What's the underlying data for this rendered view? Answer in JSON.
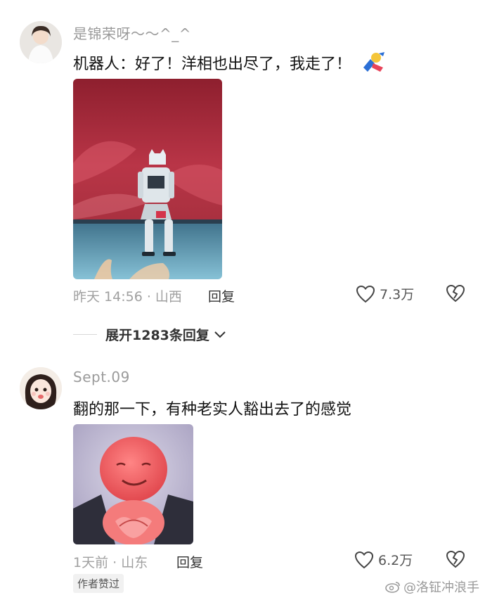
{
  "comments": [
    {
      "username": "是锦荣呀～～^_^",
      "text": "机器人：好了！洋相也出尽了，我走了！",
      "emoji_icon": "flying-toy-sticker",
      "time_location": "昨天 14:56 · 山西",
      "reply_label": "回复",
      "like_count": "7.3万",
      "media_description": "robot-on-stage-photo"
    },
    {
      "username": "Sept.09",
      "text": "翻的那一下，有种老实人豁出去了的感觉",
      "time_location": "1天前 · 山东",
      "reply_label": "回复",
      "like_count": "6.2万",
      "author_badge": "作者赞过",
      "media_description": "red-smiling-face-meme"
    }
  ],
  "expand_replies": "展开1283条回复",
  "watermark": "@洛钲冲浪手",
  "colors": {
    "muted": "#9a9a9a",
    "text": "#111111",
    "stage_red": "#b32a3c",
    "stage_floor": "#5a9db8",
    "meme_face": "#f26b6b"
  }
}
